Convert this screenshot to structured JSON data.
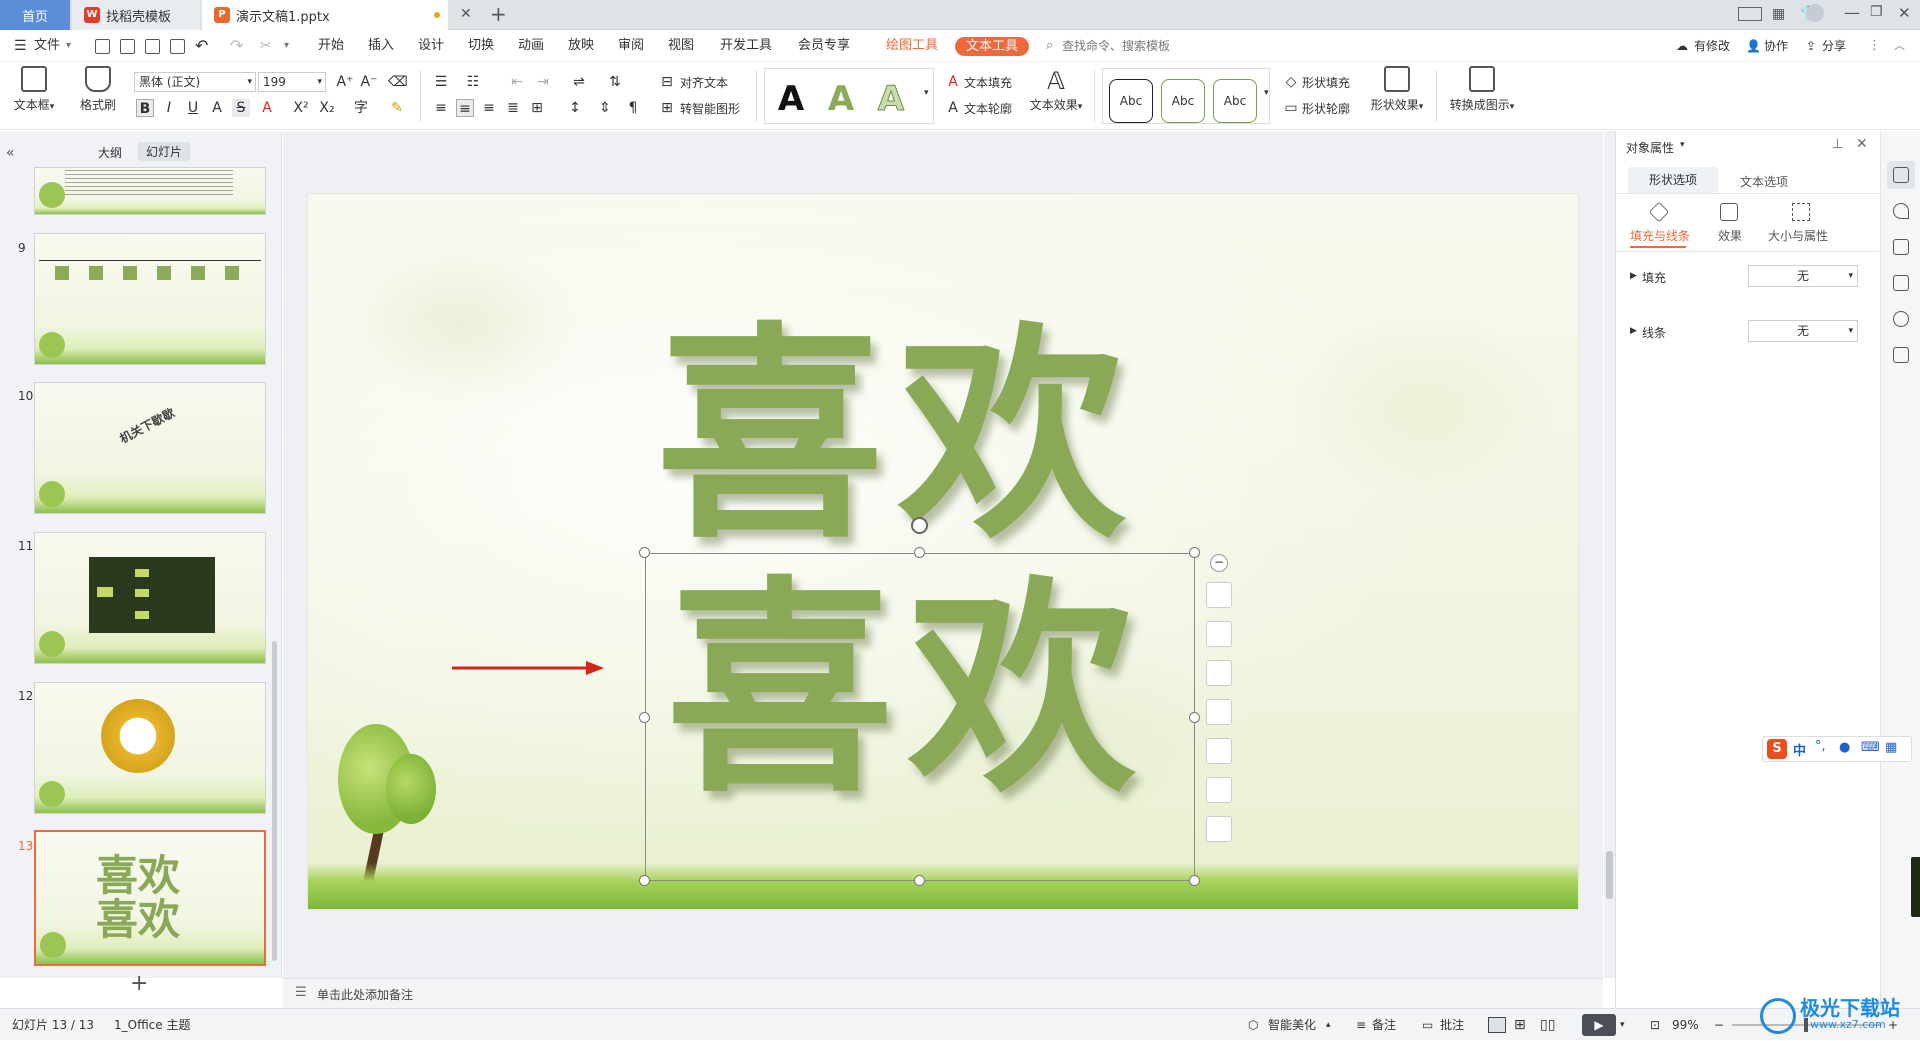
{
  "tabs": {
    "home": "首页",
    "template": "找稻壳模板",
    "doc": "演示文稿1.pptx"
  },
  "menu": {
    "file": "文件",
    "items": [
      "开始",
      "插入",
      "设计",
      "切换",
      "动画",
      "放映",
      "审阅",
      "视图",
      "开发工具",
      "会员专享"
    ],
    "draw_tool": "绘图工具",
    "text_tool": "文本工具",
    "search": "查找命令、搜索模板",
    "modified": "有修改",
    "collab": "协作",
    "share": "分享"
  },
  "ribbon": {
    "textbox": "文本框",
    "format_painter": "格式刷",
    "font": "黑体 (正文)",
    "size": "199",
    "align_text": "对齐文本",
    "smart_shape": "转智能图形",
    "text_fill": "文本填充",
    "text_outline": "文本轮廓",
    "text_effect": "文本效果",
    "abc": "Abc",
    "style_a": "A",
    "shape_fill": "形状填充",
    "shape_outline": "形状轮廓",
    "shape_effect": "形状效果",
    "convert": "转换成图示",
    "bold": "B",
    "italic": "I",
    "underline": "U",
    "strike": "S",
    "superscript": "X²",
    "subscript": "X₂"
  },
  "leftpanel": {
    "outline": "大纲",
    "slides": "幻灯片",
    "numbers": [
      "9",
      "10",
      "11",
      "12",
      "13"
    ],
    "thumb10_text": "机关下歇歇",
    "thumb13_line1": "喜欢",
    "thumb13_line2": "喜欢",
    "add": "+"
  },
  "slide": {
    "line1": [
      "喜",
      "欢"
    ],
    "line2": [
      "喜",
      "欢"
    ]
  },
  "notes": {
    "placeholder": "单击此处添加备注"
  },
  "rightpanel": {
    "title": "对象属性",
    "tab_shape": "形状选项",
    "tab_text": "文本选项",
    "sub_fill": "填充与线条",
    "sub_effect": "效果",
    "sub_size": "大小与属性",
    "fill_label": "填充",
    "fill_value": "无",
    "line_label": "线条",
    "line_value": "无"
  },
  "status": {
    "slide": "幻灯片 13 / 13",
    "theme": "1_Office 主题",
    "beautify": "智能美化",
    "notes": "备注",
    "comment": "批注",
    "zoom": "99%"
  },
  "ime": {
    "mode": "中"
  },
  "watermark": {
    "site": "极光下载站",
    "url": "www.xz7.com"
  },
  "colors": {
    "accent": "#ec6a3c",
    "text_green": "#89a956",
    "home_tab": "#5b8dd9",
    "arrow": "#d9241c"
  }
}
